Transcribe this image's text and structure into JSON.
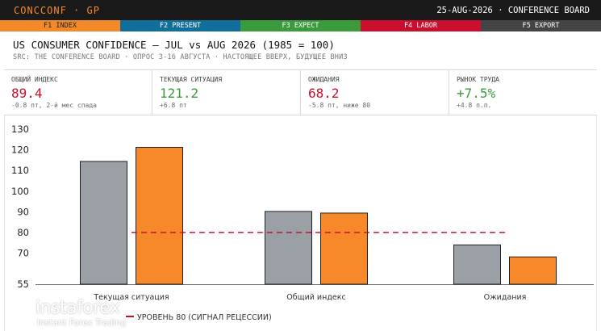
{
  "topbar": {
    "brand": "CONCCONF · GP",
    "date": "25-AUG-2026 · CONFERENCE BOARD"
  },
  "fkeys": [
    {
      "label": "F1 INDEX",
      "color": "#f28a2a",
      "text_color": "#222222"
    },
    {
      "label": "F2 PRESENT",
      "color": "#0f6f9a",
      "text_color": "#ffffff"
    },
    {
      "label": "F3 EXPECT",
      "color": "#3a9a3c",
      "text_color": "#ffffff"
    },
    {
      "label": "F4 LABOR",
      "color": "#c8102e",
      "text_color": "#ffffff"
    },
    {
      "label": "F5 EXPORT",
      "color": "#444444",
      "text_color": "#ffffff"
    }
  ],
  "header": {
    "title": "US CONSUMER CONFIDENCE — JUL vs AUG 2026 (1985 = 100)",
    "subtitle": "SRC: THE CONFERENCE BOARD · ОПРОС 3-16 АВГУСТА · НАСТОЯЩЕЕ ВВЕРХ, БУДУЩЕЕ ВНИЗ"
  },
  "cards": [
    {
      "label": "ОБЩИЙ ИНДЕКС",
      "value": "89.4",
      "note": "-0.8 пт, 2-й мес спада",
      "color": "#c8102e"
    },
    {
      "label": "ТЕКУЩАЯ СИТУАЦИЯ",
      "value": "121.2",
      "note": "+6.8 пт",
      "color": "#3a9a3c"
    },
    {
      "label": "ОЖИДАНИЯ",
      "value": "68.2",
      "note": "-5.8 пт, ниже 80",
      "color": "#c8102e"
    },
    {
      "label": "РЫНОК ТРУДА",
      "value": "+7.5%",
      "note": "+4.8 п.п.",
      "color": "#3a9a3c"
    }
  ],
  "chart_data": {
    "type": "bar",
    "categories": [
      "Текущая ситуация",
      "Общий индекс",
      "Ожидания"
    ],
    "series": [
      {
        "values": [
          114.4,
          90.2,
          74.0
        ],
        "color": "#9aa0a6"
      },
      {
        "values": [
          121.2,
          89.4,
          68.2
        ],
        "color": "#f7892a"
      }
    ],
    "y_ticks": [
      55,
      70,
      80,
      90,
      100,
      110,
      120,
      130
    ],
    "ylim": [
      55,
      130
    ],
    "reference_line": {
      "value": 80,
      "color": "#c8102e",
      "label": "УРОВЕНЬ 80 (СИГНАЛ РЕЦЕССИИ)"
    },
    "grid": false
  },
  "logo": {
    "name": "instaforex",
    "tagline": "Instant Forex Trading"
  }
}
